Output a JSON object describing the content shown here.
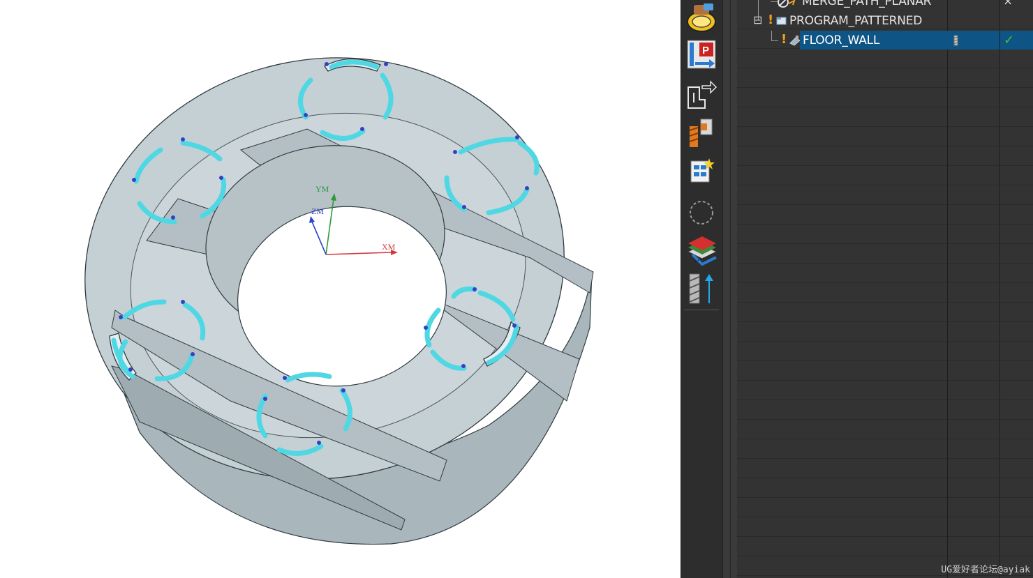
{
  "viewport": {
    "csys": {
      "x_label": "XM",
      "y_label": "YM",
      "z_label": "ZM"
    },
    "colors": {
      "part_face": "#c3ced3",
      "part_side": "#a9b6bc",
      "part_edge": "#2f3b40",
      "toolpath": "#4fd8e4",
      "axis_x": "#d23a3a",
      "axis_y": "#2e9a3a",
      "axis_z": "#2b46c8"
    }
  },
  "toolbar": {
    "items": [
      {
        "icon": "create-operation-icon"
      },
      {
        "icon": "create-program-icon"
      },
      {
        "icon": "create-geometry-icon"
      },
      {
        "icon": "create-tool-icon"
      },
      {
        "icon": "create-method-icon"
      },
      {
        "icon": "feature-circle-icon"
      },
      {
        "icon": "generate-toolpath-icon"
      },
      {
        "icon": "tool-axis-icon"
      }
    ]
  },
  "navigator": {
    "rows": [
      {
        "name": "MERGE_PATH_PLANAR",
        "status": "×",
        "warning": false
      },
      {
        "name": "PROGRAM_PATTERNED",
        "status": "",
        "warning": true,
        "expanded": "⊟"
      },
      {
        "name": "FLOOR_WALL",
        "status": "✓",
        "warning": true,
        "selected": true
      }
    ]
  },
  "watermark": "UG爱好者论坛@ayiak"
}
